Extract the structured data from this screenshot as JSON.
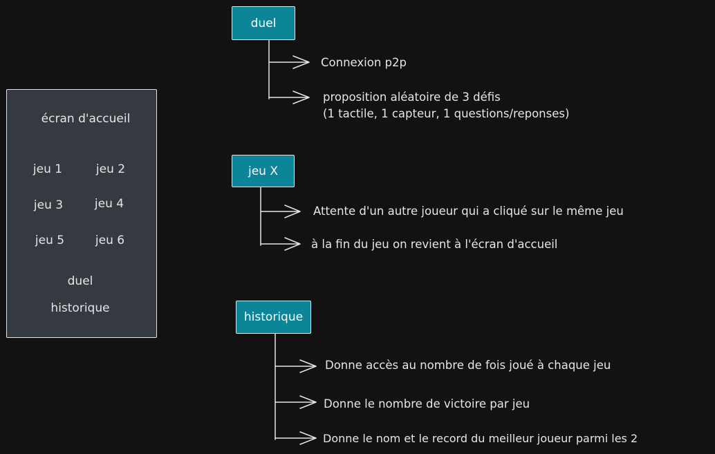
{
  "colors": {
    "background": "#121212",
    "panel_fill": "#343a40",
    "node_fill": "#0c8599",
    "stroke": "#e6e6e6"
  },
  "home_screen": {
    "title": "écran d'accueil",
    "games": [
      "jeu 1",
      "jeu 2",
      "jeu 3",
      "jeu 4",
      "jeu 5",
      "jeu 6"
    ],
    "duel": "duel",
    "history": "historique"
  },
  "nodes": [
    {
      "label": "duel",
      "items": [
        "Connexion p2p",
        "proposition aléatoire de 3 défis",
        "(1 tactile, 1 capteur, 1 questions/reponses)"
      ]
    },
    {
      "label": "jeu X",
      "items": [
        "Attente d'un autre joueur qui a cliqué sur le même jeu",
        "à la fin du jeu on revient à l'écran d'accueil"
      ]
    },
    {
      "label": "historique",
      "items": [
        "Donne accès au nombre de fois joué à chaque jeu",
        "Donne le nombre de victoire par jeu",
        "Donne le nom et le record du meilleur joueur parmi les 2"
      ]
    }
  ]
}
